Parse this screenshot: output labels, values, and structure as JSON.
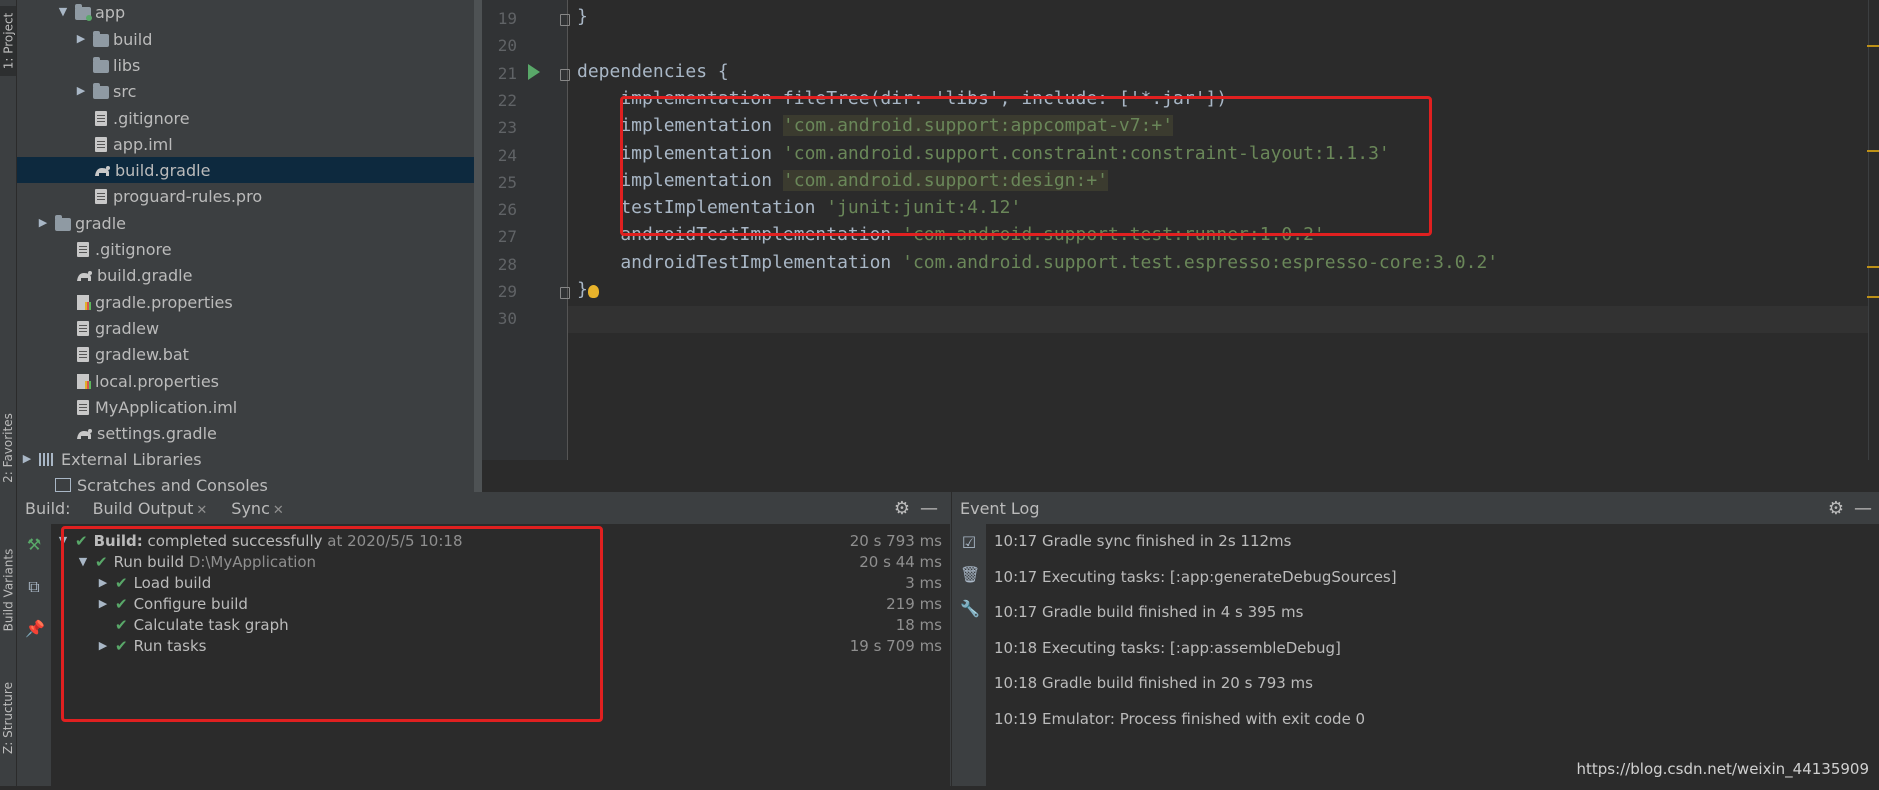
{
  "left_tabs": {
    "project": "1: Project",
    "favorites": "2: Favorites",
    "build_variants": "Build Variants",
    "structure": "Z: Structure"
  },
  "tree": [
    {
      "label": "app",
      "icon": "folder-module-icon",
      "arrow": "▼"
    },
    {
      "label": "build",
      "icon": "folder-icon",
      "arrow": "▶"
    },
    {
      "label": "libs",
      "icon": "folder-icon",
      "arrow": ""
    },
    {
      "label": "src",
      "icon": "folder-icon",
      "arrow": "▶"
    },
    {
      "label": ".gitignore",
      "icon": "file-icon",
      "arrow": ""
    },
    {
      "label": "app.iml",
      "icon": "file-icon",
      "arrow": ""
    },
    {
      "label": "build.gradle",
      "icon": "gradle-icon",
      "arrow": ""
    },
    {
      "label": "proguard-rules.pro",
      "icon": "file-icon",
      "arrow": ""
    },
    {
      "label": "gradle",
      "icon": "folder-icon",
      "arrow": "▶"
    },
    {
      "label": ".gitignore",
      "icon": "file-icon",
      "arrow": ""
    },
    {
      "label": "build.gradle",
      "icon": "gradle-icon",
      "arrow": ""
    },
    {
      "label": "gradle.properties",
      "icon": "properties-icon",
      "arrow": ""
    },
    {
      "label": "gradlew",
      "icon": "file-icon",
      "arrow": ""
    },
    {
      "label": "gradlew.bat",
      "icon": "file-icon",
      "arrow": ""
    },
    {
      "label": "local.properties",
      "icon": "properties-icon",
      "arrow": ""
    },
    {
      "label": "MyApplication.iml",
      "icon": "file-icon",
      "arrow": ""
    },
    {
      "label": "settings.gradle",
      "icon": "gradle-icon",
      "arrow": ""
    },
    {
      "label": "External Libraries",
      "icon": "library-icon",
      "arrow": "▶"
    },
    {
      "label": "Scratches and Consoles",
      "icon": "scratch-icon",
      "arrow": ""
    }
  ],
  "editor": {
    "line_numbers": [
      "19",
      "20",
      "21",
      "22",
      "23",
      "24",
      "25",
      "26",
      "27",
      "28",
      "29",
      "30"
    ],
    "lines": [
      {
        "text": "}",
        "str": ""
      },
      {
        "text": "",
        "str": ""
      },
      {
        "text": "dependencies {",
        "str": ""
      },
      {
        "text": "    implementation fileTree(dir: 'libs', include: ['*.jar'])",
        "str": ""
      },
      {
        "text": "    implementation ",
        "str": "'com.android.support:appcompat-v7:+'"
      },
      {
        "text": "    implementation ",
        "str": "'com.android.support.constraint:constraint-layout:1.1.3'"
      },
      {
        "text": "    implementation ",
        "str": "'com.android.support:design:+'"
      },
      {
        "text": "    testImplementation ",
        "str": "'junit:junit:4.12'"
      },
      {
        "text": "    androidTestImplementation ",
        "str": "'com.android.support.test:runner:1.0.2'"
      },
      {
        "text": "    androidTestImplementation ",
        "str": "'com.android.support.test.espresso:espresso-core:3.0.2'"
      },
      {
        "text": "}",
        "str": ""
      },
      {
        "text": "",
        "str": ""
      }
    ]
  },
  "build_panel": {
    "label": "Build:",
    "tabs": [
      "Build Output",
      "Sync"
    ],
    "rows": [
      {
        "arrow": "▼",
        "bold": "Build:",
        "text": " completed successfully",
        "muted": " at 2020/5/5 10:18",
        "time": "20 s 793 ms"
      },
      {
        "arrow": "▼",
        "bold": "",
        "text": "Run build",
        "muted": " D:\\MyApplication",
        "time": "20 s 44 ms"
      },
      {
        "arrow": "▶",
        "bold": "",
        "text": "Load build",
        "muted": "",
        "time": "3 ms"
      },
      {
        "arrow": "▶",
        "bold": "",
        "text": "Configure build",
        "muted": "",
        "time": "219 ms"
      },
      {
        "arrow": "",
        "bold": "",
        "text": "Calculate task graph",
        "muted": "",
        "time": "18 ms"
      },
      {
        "arrow": "▶",
        "bold": "",
        "text": "Run tasks",
        "muted": "",
        "time": "19 s 709 ms"
      }
    ]
  },
  "event_log": {
    "title": "Event Log",
    "entries": [
      "10:17 Gradle sync finished in 2s 112ms",
      "10:17 Executing tasks: [:app:generateDebugSources]",
      "10:17 Gradle build finished in 4 s 395 ms",
      "10:18 Executing tasks: [:app:assembleDebug]",
      "10:18 Gradle build finished in 20 s 793 ms",
      "10:19 Emulator: Process finished with exit code 0"
    ]
  },
  "watermark": "https://blog.csdn.net/weixin_44135909",
  "colors": {
    "annotation_red": "#e02020",
    "success_green": "#59a869",
    "string_green": "#6a8759",
    "selection": "#0d293e"
  }
}
